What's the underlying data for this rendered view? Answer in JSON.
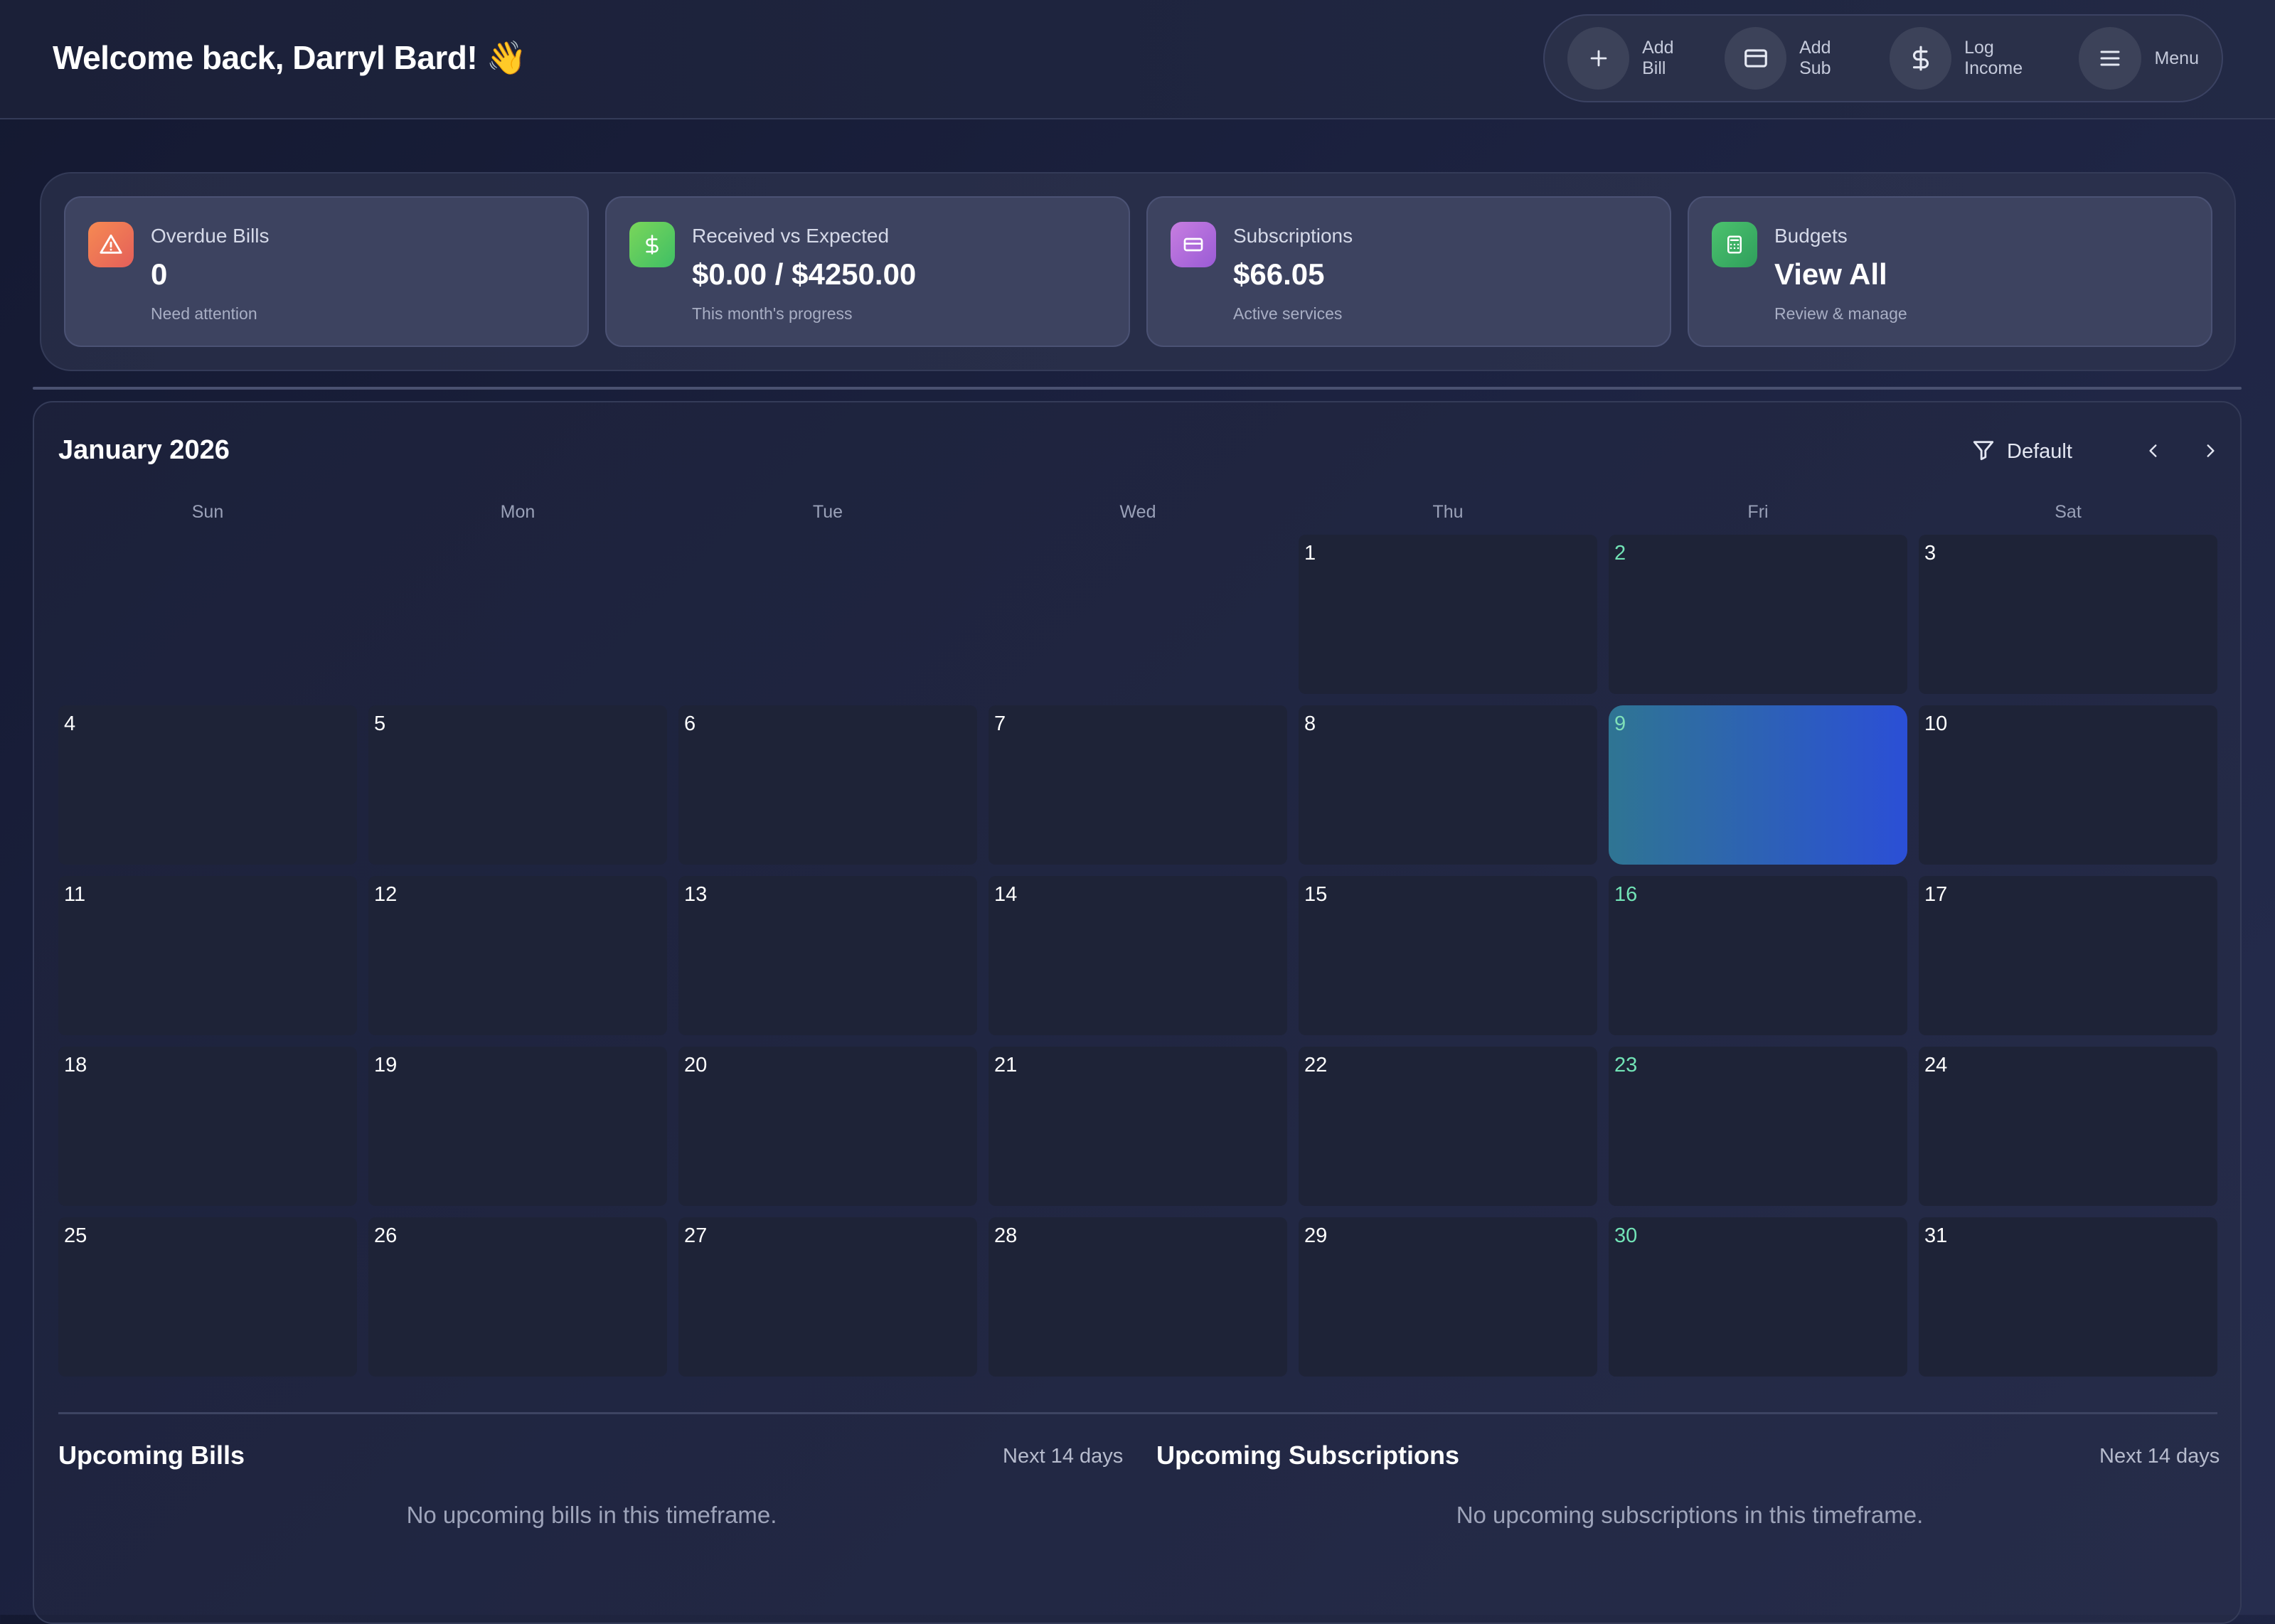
{
  "header": {
    "welcome": "Welcome back, Darryl Bard! 👋",
    "actions": [
      {
        "label": "Add Bill",
        "icon": "plus-icon"
      },
      {
        "label": "Add Sub",
        "icon": "card-icon"
      },
      {
        "label": "Log Income",
        "icon": "dollar-icon"
      },
      {
        "label": "Menu",
        "icon": "menu-icon"
      }
    ]
  },
  "stats": [
    {
      "title": "Overdue Bills",
      "value": "0",
      "subtitle": "Need attention",
      "icon": "warning-icon",
      "color": "#f07a48"
    },
    {
      "title": "Received vs Expected",
      "value": "$0.00 / $4250.00",
      "subtitle": "This month's progress",
      "icon": "dollar-icon",
      "color": "#5cc95a"
    },
    {
      "title": "Subscriptions",
      "value": "$66.05",
      "subtitle": "Active services",
      "icon": "card-icon",
      "color": "#b66fd8"
    },
    {
      "title": "Budgets",
      "value": "View All",
      "subtitle": "Review & manage",
      "icon": "calculator-icon",
      "color": "#3fb56a"
    }
  ],
  "calendar": {
    "month_label": "January 2026",
    "filter_label": "Default",
    "weekdays": [
      "Sun",
      "Mon",
      "Tue",
      "Wed",
      "Thu",
      "Fri",
      "Sat"
    ],
    "days": [
      "1",
      "2",
      "3",
      "4",
      "5",
      "6",
      "7",
      "8",
      "9",
      "10",
      "11",
      "12",
      "13",
      "14",
      "15",
      "16",
      "17",
      "18",
      "19",
      "20",
      "21",
      "22",
      "23",
      "24",
      "25",
      "26",
      "27",
      "28",
      "29",
      "30",
      "31"
    ],
    "today": "9",
    "today_gradient": [
      "#2f7593",
      "#2b4fd6"
    ],
    "friday_color": "#72e3b6"
  },
  "upcoming_bills": {
    "title": "Upcoming Bills",
    "range": "Next 14 days",
    "empty": "No upcoming bills in this timeframe."
  },
  "upcoming_subscriptions": {
    "title": "Upcoming Subscriptions",
    "range": "Next 14 days",
    "empty": "No upcoming subscriptions in this timeframe."
  }
}
